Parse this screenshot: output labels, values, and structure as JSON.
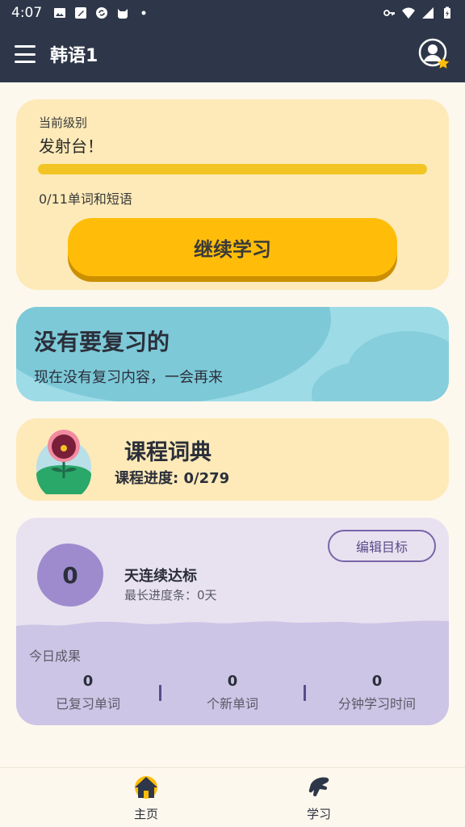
{
  "status_bar": {
    "time": "4:07",
    "icons": [
      "image-icon",
      "edit-icon",
      "sync-icon",
      "cat-icon",
      "dot-icon"
    ],
    "right_icons": [
      "key-icon",
      "wifi-icon",
      "signal-icon",
      "battery-icon"
    ]
  },
  "app_bar": {
    "title": "韩语1",
    "menu_icon": "menu-icon",
    "profile_icon": "profile-star-icon"
  },
  "level_card": {
    "label": "当前级别",
    "level_name": "发射台！",
    "progress": 0,
    "words_text": "0/11单词和短语",
    "continue_button": "继续学习"
  },
  "review_card": {
    "heading": "没有要复习的",
    "subtext": "现在没有复习内容，一会再来"
  },
  "dictionary_card": {
    "heading": "课程词典",
    "progress_text": "课程进度: 0/279",
    "icon": "flower-icon"
  },
  "streak_card": {
    "streak_count": "0",
    "edit_goal_button": "编辑目标",
    "days_label": "天连续达标",
    "longest_text": "最长进度条：0天",
    "today_label": "今日成果",
    "stats": [
      {
        "value": "0",
        "label": "已复习单词"
      },
      {
        "value": "0",
        "label": "个新单词"
      },
      {
        "value": "0",
        "label": "分钟学习时间"
      }
    ]
  },
  "bottom_nav": {
    "items": [
      {
        "label": "主页",
        "icon": "home-icon"
      },
      {
        "label": "学习",
        "icon": "learn-hand-icon"
      }
    ]
  },
  "colors": {
    "app_bar": "#2e3749",
    "level_card": "#fdeab8",
    "accent_yellow": "#ffbd0a",
    "review_card": "#9ddbe6",
    "streak_purple": "#9e8bce"
  }
}
